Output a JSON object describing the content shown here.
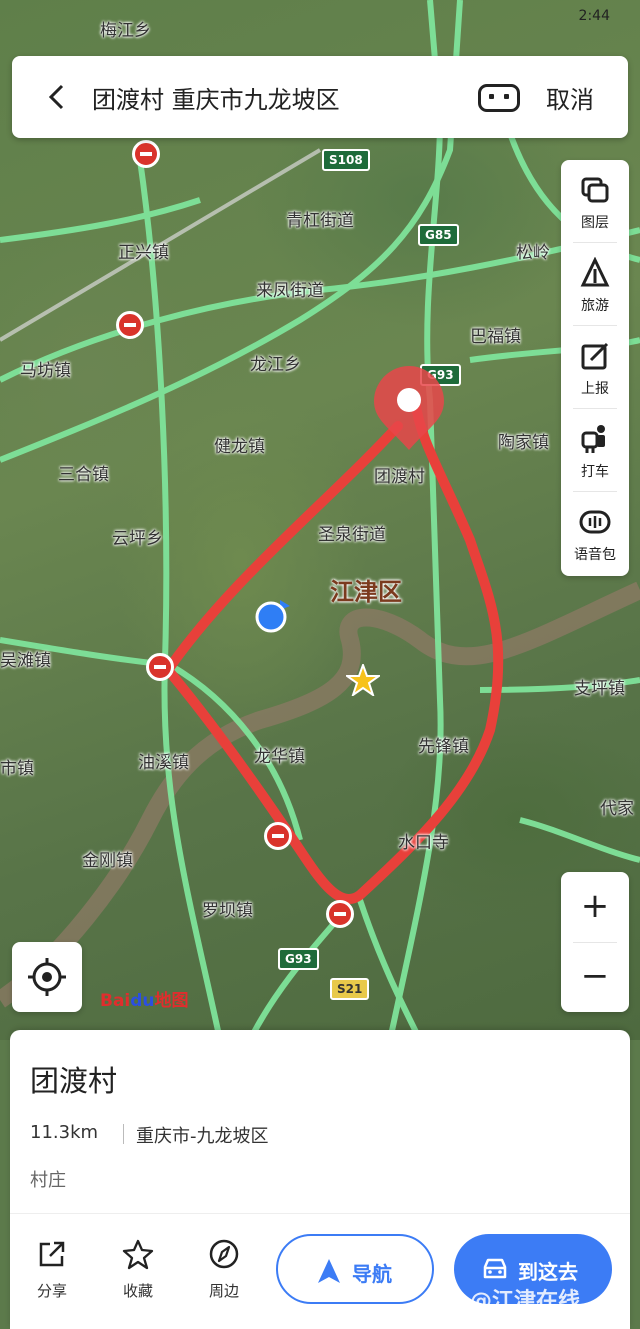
{
  "status": {
    "time": "2:44"
  },
  "search": {
    "title": "团渡村 重庆市九龙坡区",
    "cancel_label": "取消"
  },
  "toolbar": {
    "items": [
      {
        "label": "图层",
        "icon": "layers-icon"
      },
      {
        "label": "旅游",
        "icon": "travel-icon"
      },
      {
        "label": "上报",
        "icon": "report-icon"
      },
      {
        "label": "打车",
        "icon": "taxi-icon"
      },
      {
        "label": "语音包",
        "icon": "voice-pack-icon"
      }
    ]
  },
  "zoom": {
    "in_label": "+",
    "out_label": "−"
  },
  "map": {
    "district": "江津区",
    "places": [
      "梅江乡",
      "马坊镇",
      "正兴镇",
      "来凤街道",
      "青杠街道",
      "龙江乡",
      "巴福镇",
      "三合镇",
      "健龙镇",
      "陶家镇",
      "云坪乡",
      "团渡村",
      "圣泉街道",
      "吴滩镇",
      "支坪镇",
      "油溪镇",
      "龙华镇",
      "先锋镇",
      "市镇",
      "金刚镇",
      "水口寺",
      "代家",
      "罗坝镇",
      "松岭"
    ],
    "highways": [
      "S108",
      "G85",
      "G93",
      "S21",
      "G93"
    ],
    "logo_a": "Bai",
    "logo_b": "du",
    "logo_c": "地图",
    "colors": {
      "road": "#7fe39a",
      "route": "#e8403a",
      "marker": "#e8464a",
      "location": "#2f7ef5"
    }
  },
  "card": {
    "name": "团渡村",
    "distance": "11.3km",
    "address": "重庆市-九龙坡区",
    "category": "村庄",
    "actions": [
      {
        "label": "分享",
        "icon": "share-icon"
      },
      {
        "label": "收藏",
        "icon": "star-icon"
      },
      {
        "label": "周边",
        "icon": "compass-icon"
      }
    ],
    "nav_label": "导航",
    "go_label": "到这去"
  },
  "watermark": "@江津在线"
}
